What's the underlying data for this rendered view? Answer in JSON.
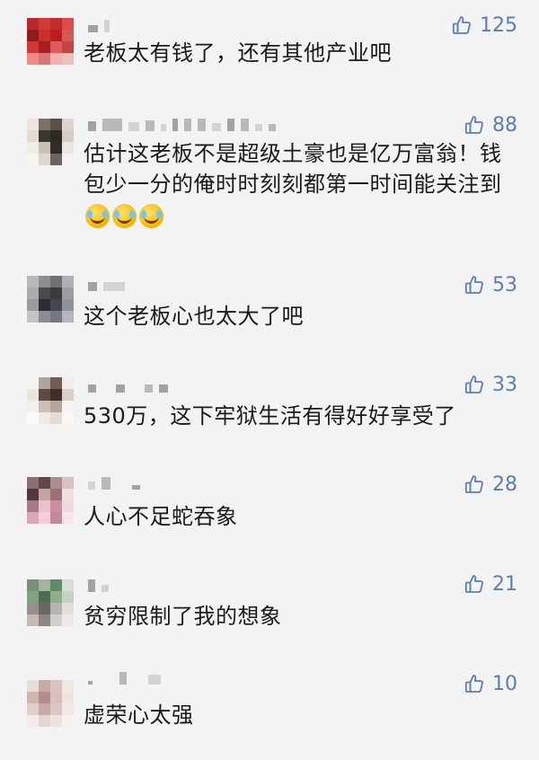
{
  "comments": [
    {
      "text": "老板太有钱了，还有其他产业吧",
      "likes": "125",
      "avatar_colors": [
        "#b52a2a",
        "#d43b34",
        "#c22c2d",
        "#e04944",
        "#8e1c1f",
        "#c92f2f",
        "#b71f22",
        "#d35a54",
        "#d03939",
        "#a81f22",
        "#e05c5c",
        "#c34346",
        "#f08b84",
        "#d67574",
        "#f2b1b0",
        "#e8c0bd"
      ]
    },
    {
      "text": "估计这老板不是超级土豪也是亿万富翁！钱包少一分的俺时时刻刻都第一时间能关注到",
      "likes": "88",
      "emoji_count": 3,
      "avatar_colors": [
        "#ece6df",
        "#7d6f64",
        "#5a5047",
        "#ddd5cd",
        "#e3ddd5",
        "#3c3630",
        "#2c2825",
        "#d6cec4",
        "#f0ece7",
        "#c9c1b6",
        "#2e2b29",
        "#ebe6e0",
        "#f7f4f1",
        "#ddd7d0",
        "#6c6460",
        "#f4f1ee"
      ]
    },
    {
      "text": "这个老板心也太大了吧",
      "likes": "53",
      "avatar_colors": [
        "#b8b8bb",
        "#8c8e94",
        "#6d7075",
        "#aeb0b5",
        "#a9abaf",
        "#484a50",
        "#393b41",
        "#9c9ea3",
        "#9a9ca0",
        "#2b2d33",
        "#454750",
        "#90929a",
        "#c1c3c7",
        "#8b8d94",
        "#767880",
        "#b4b6bb"
      ]
    },
    {
      "text": "530万，这下牢狱生活有得好好享受了",
      "likes": "33",
      "avatar_colors": [
        "#f6f2ef",
        "#b0a59c",
        "#6f5c52",
        "#f1ece8",
        "#ebe4df",
        "#5d4a40",
        "#3e3029",
        "#d9cfc8",
        "#f3efec",
        "#cdbfb6",
        "#b8a59a",
        "#f6f3f0",
        "#fbfaf8",
        "#efe9e5",
        "#e3dbd5",
        "#faf8f6"
      ]
    },
    {
      "text": "人心不足蛇吞象",
      "likes": "28",
      "avatar_colors": [
        "#8a6f73",
        "#5f4648",
        "#a98d90",
        "#d6c2c4",
        "#4e3a3e",
        "#c4a3a6",
        "#9d7075",
        "#efe0e2",
        "#a97a84",
        "#e8c1cc",
        "#c78fa0",
        "#f1d7de",
        "#d8a8b8",
        "#f3cddb",
        "#bf8aa0",
        "#f8e6ec"
      ]
    },
    {
      "text": "贫穷限制了我的想象",
      "likes": "21",
      "avatar_colors": [
        "#7d8f76",
        "#a2b59a",
        "#5e8c69",
        "#d8ddd5",
        "#7fa47f",
        "#4d6e52",
        "#8fae88",
        "#c8d1c5",
        "#9a8e8c",
        "#6b6763",
        "#b9b3af",
        "#e1deda",
        "#c7b9b6",
        "#8c8684",
        "#d4cdca",
        "#ece9e7"
      ]
    },
    {
      "text": "虚荣心太强",
      "likes": "10",
      "avatar_colors": [
        "#e9dcd8",
        "#c9a9a6",
        "#dcc3c0",
        "#f1e6e3",
        "#cfb4b2",
        "#b28d8c",
        "#d7c0bf",
        "#efe3e1",
        "#e0cecc",
        "#c6aaa8",
        "#dbc7c5",
        "#f2e9e7",
        "#f3ecea",
        "#e2d6d4",
        "#ece2e0",
        "#f7f2f1"
      ]
    }
  ]
}
